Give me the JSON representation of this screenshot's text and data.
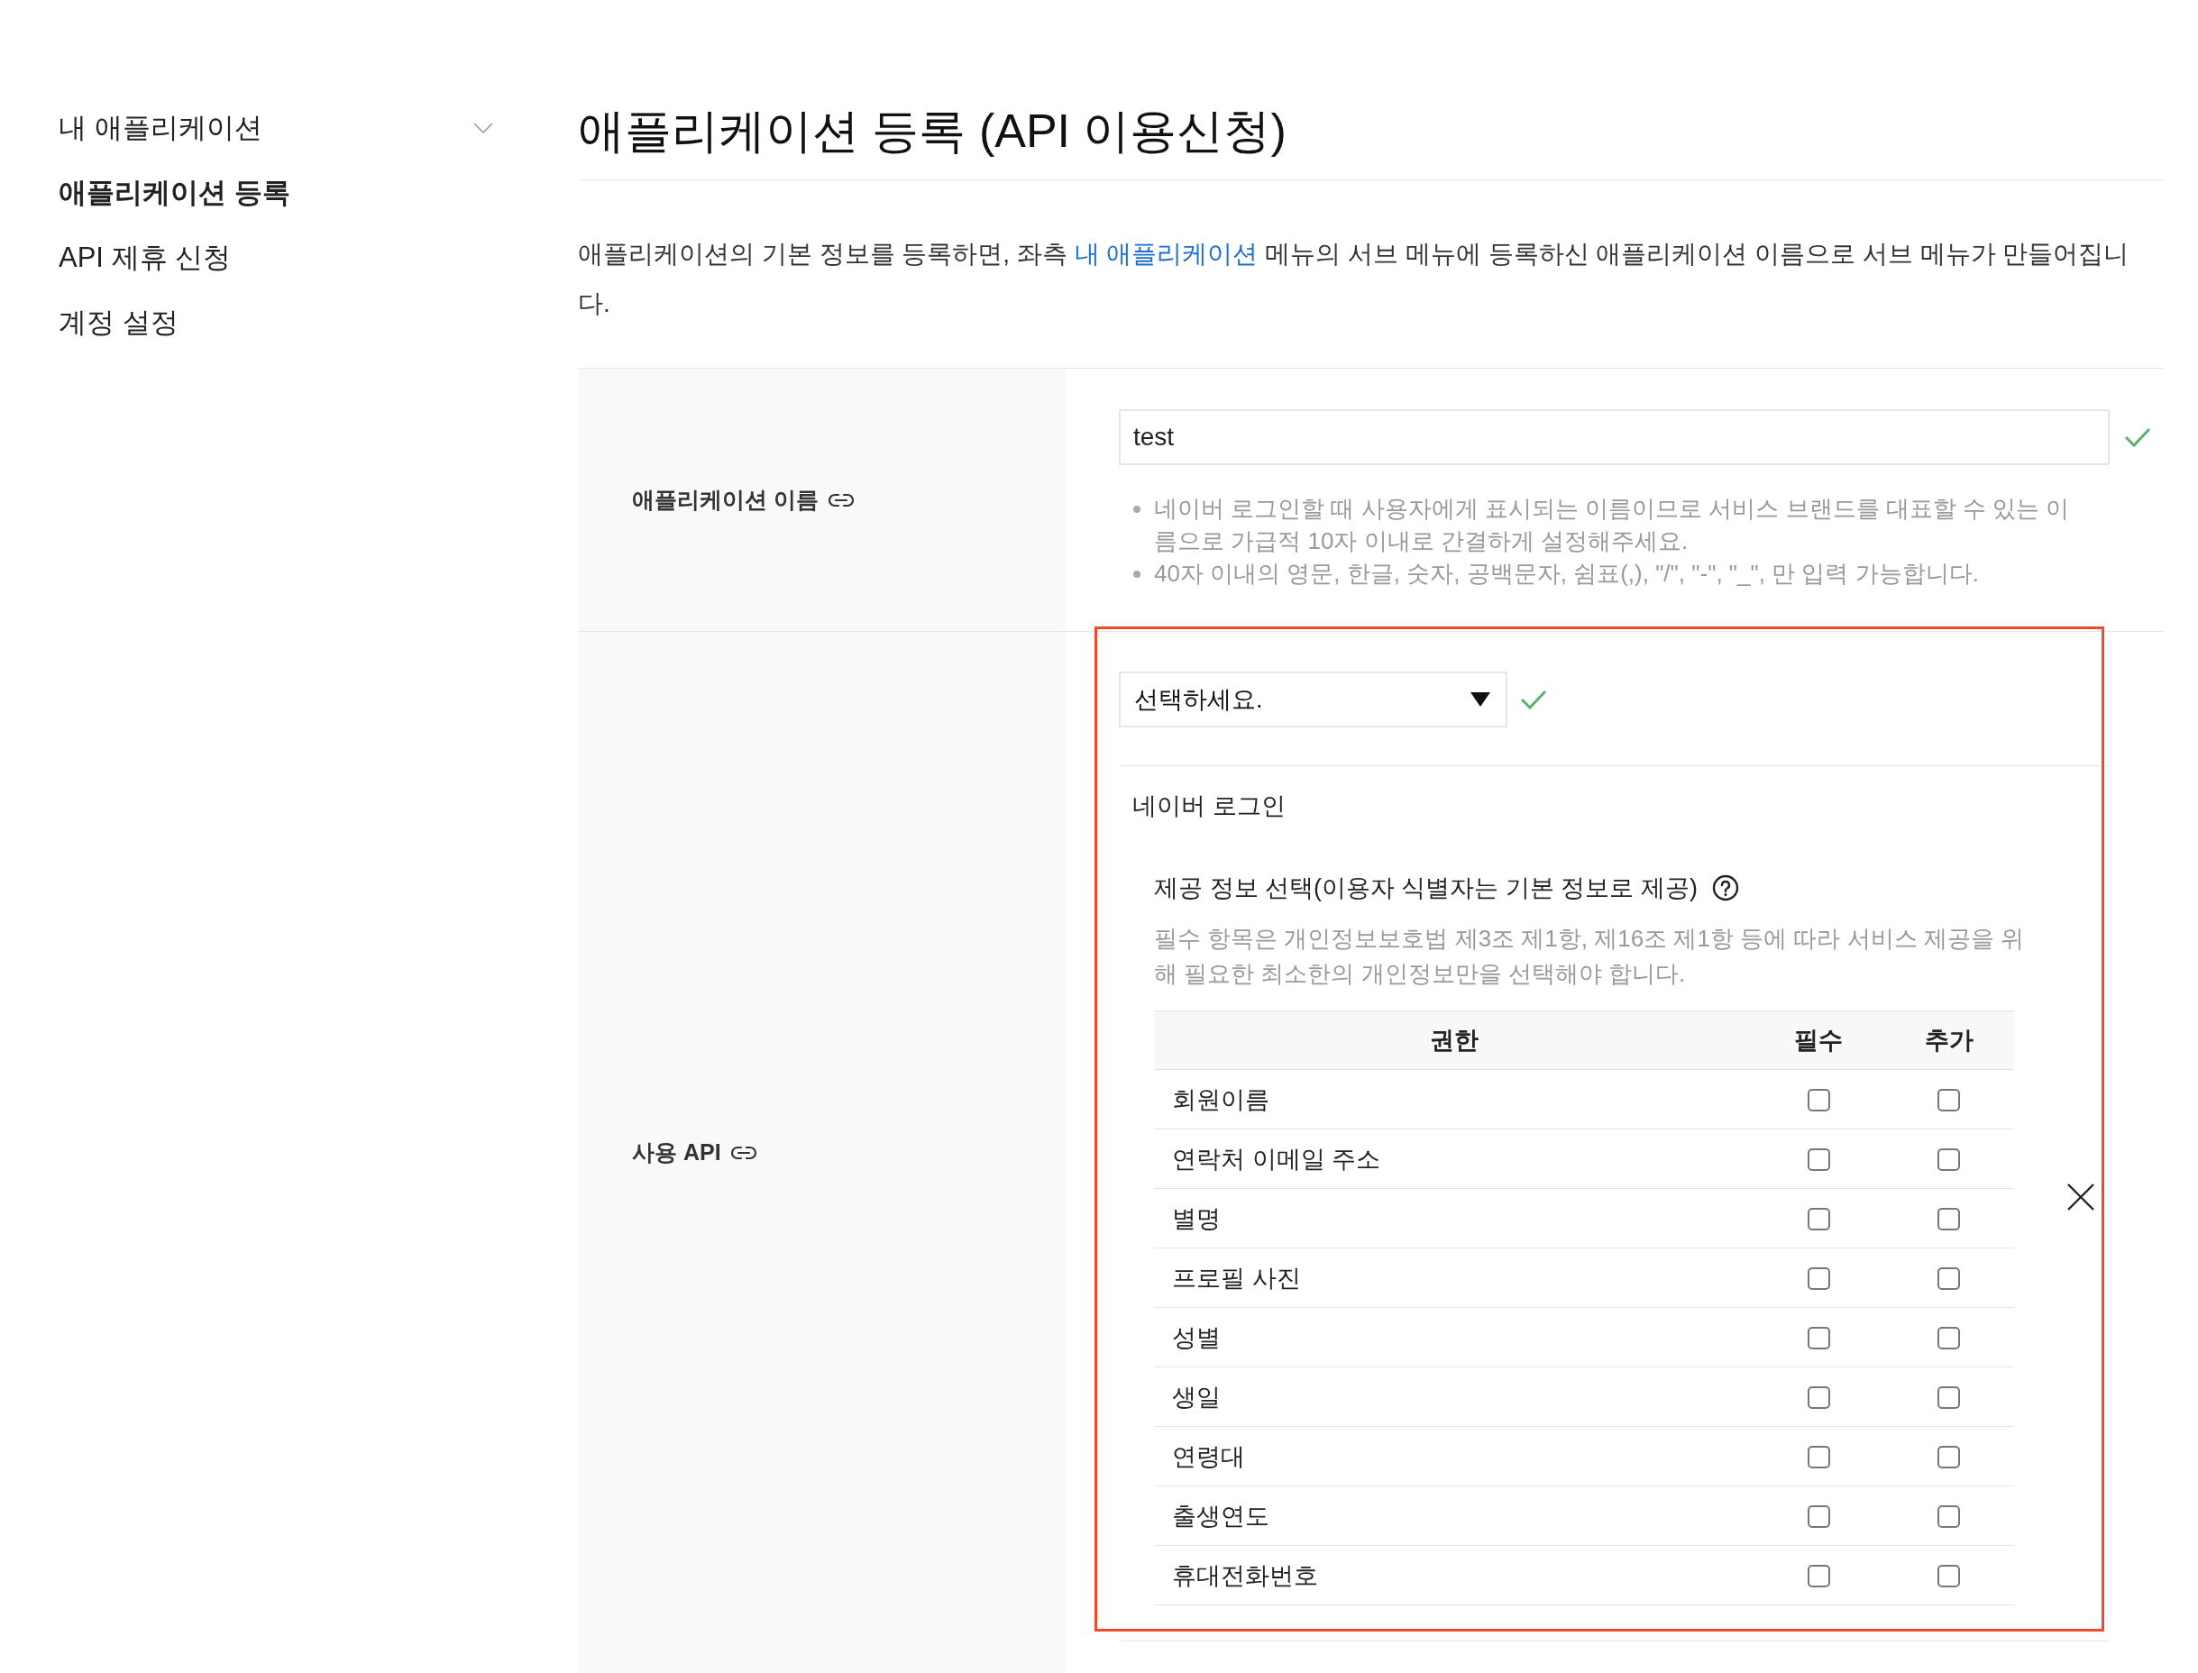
{
  "sidebar": {
    "items": [
      {
        "kind": "group",
        "label": "내 애플리케이션",
        "selected": false,
        "expanded": false
      },
      {
        "kind": "link",
        "label": "애플리케이션 등록",
        "selected": true
      },
      {
        "kind": "link",
        "label": "API 제휴 신청",
        "selected": false
      },
      {
        "kind": "link",
        "label": "계정 설정",
        "selected": false
      }
    ]
  },
  "page": {
    "title": "애플리케이션 등록 (API 이용신청)",
    "description": {
      "before": "애플리케이션의 기본 정보를 등록하면, 좌측 ",
      "link": "내 애플리케이션",
      "after": " 메뉴의 서브 메뉴에 등록하신 애플리케이션 이름으로 서브 메뉴가 만들어집니다."
    }
  },
  "form": {
    "rows": [
      {
        "kind": "text",
        "label": "애플리케이션 이름",
        "value": "test",
        "valid": true,
        "hints": [
          "네이버 로그인할 때 사용자에게 표시되는 이름이므로 서비스 브랜드를 대표할 수 있는 이름으로 가급적 10자 이내로 간결하게 설정해주세요.",
          "40자 이내의 영문, 한글, 숫자, 공백문자, 쉼표(,), \"/\", \"-\", \"_\", 만 입력 가능합니다."
        ]
      },
      {
        "kind": "api",
        "label": "사용 API",
        "highlighted": true,
        "select": {
          "value": "선택하세요.",
          "valid": true
        },
        "apis": [
          {
            "name": "네이버 로그인",
            "section_title": "제공 정보 선택(이용자 식별자는 기본 정보로 제공)",
            "note": "필수 항목은 개인정보보호법 제3조 제1항, 제16조 제1항 등에 따라 서비스 제공을 위해 필요한 최소한의 개인정보만을 선택해야 합니다.",
            "columns": [
              "권한",
              "필수",
              "추가"
            ],
            "rows": [
              {
                "name": "회원이름",
                "required": false,
                "additional": false
              },
              {
                "name": "연락처 이메일 주소",
                "required": false,
                "additional": false
              },
              {
                "name": "별명",
                "required": false,
                "additional": false
              },
              {
                "name": "프로필 사진",
                "required": false,
                "additional": false
              },
              {
                "name": "성별",
                "required": false,
                "additional": false
              },
              {
                "name": "생일",
                "required": false,
                "additional": false
              },
              {
                "name": "연령대",
                "required": false,
                "additional": false
              },
              {
                "name": "출생연도",
                "required": false,
                "additional": false
              },
              {
                "name": "휴대전화번호",
                "required": false,
                "additional": false
              }
            ]
          }
        ]
      }
    ]
  }
}
